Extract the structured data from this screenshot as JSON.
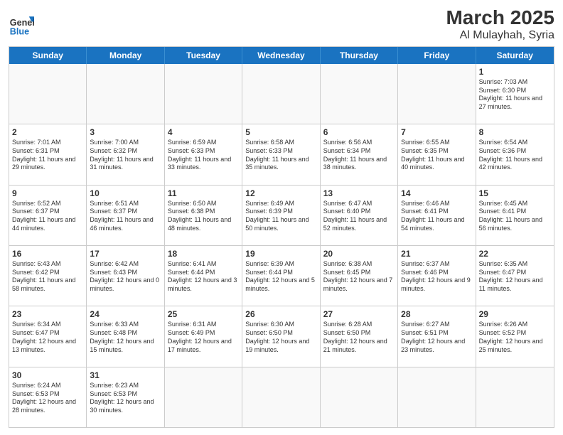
{
  "header": {
    "logo_general": "General",
    "logo_blue": "Blue",
    "title": "March 2025",
    "subtitle": "Al Mulayhah, Syria"
  },
  "days": [
    "Sunday",
    "Monday",
    "Tuesday",
    "Wednesday",
    "Thursday",
    "Friday",
    "Saturday"
  ],
  "weeks": [
    [
      {
        "day": "",
        "empty": true
      },
      {
        "day": "",
        "empty": true
      },
      {
        "day": "",
        "empty": true
      },
      {
        "day": "",
        "empty": true
      },
      {
        "day": "",
        "empty": true
      },
      {
        "day": "",
        "empty": true
      },
      {
        "day": "1",
        "sunrise": "7:03 AM",
        "sunset": "6:30 PM",
        "daylight": "11 hours and 27 minutes."
      }
    ],
    [
      {
        "day": "2",
        "sunrise": "7:01 AM",
        "sunset": "6:31 PM",
        "daylight": "11 hours and 29 minutes."
      },
      {
        "day": "3",
        "sunrise": "7:00 AM",
        "sunset": "6:32 PM",
        "daylight": "11 hours and 31 minutes."
      },
      {
        "day": "4",
        "sunrise": "6:59 AM",
        "sunset": "6:33 PM",
        "daylight": "11 hours and 33 minutes."
      },
      {
        "day": "5",
        "sunrise": "6:58 AM",
        "sunset": "6:33 PM",
        "daylight": "11 hours and 35 minutes."
      },
      {
        "day": "6",
        "sunrise": "6:56 AM",
        "sunset": "6:34 PM",
        "daylight": "11 hours and 38 minutes."
      },
      {
        "day": "7",
        "sunrise": "6:55 AM",
        "sunset": "6:35 PM",
        "daylight": "11 hours and 40 minutes."
      },
      {
        "day": "8",
        "sunrise": "6:54 AM",
        "sunset": "6:36 PM",
        "daylight": "11 hours and 42 minutes."
      }
    ],
    [
      {
        "day": "9",
        "sunrise": "6:52 AM",
        "sunset": "6:37 PM",
        "daylight": "11 hours and 44 minutes."
      },
      {
        "day": "10",
        "sunrise": "6:51 AM",
        "sunset": "6:37 PM",
        "daylight": "11 hours and 46 minutes."
      },
      {
        "day": "11",
        "sunrise": "6:50 AM",
        "sunset": "6:38 PM",
        "daylight": "11 hours and 48 minutes."
      },
      {
        "day": "12",
        "sunrise": "6:49 AM",
        "sunset": "6:39 PM",
        "daylight": "11 hours and 50 minutes."
      },
      {
        "day": "13",
        "sunrise": "6:47 AM",
        "sunset": "6:40 PM",
        "daylight": "11 hours and 52 minutes."
      },
      {
        "day": "14",
        "sunrise": "6:46 AM",
        "sunset": "6:41 PM",
        "daylight": "11 hours and 54 minutes."
      },
      {
        "day": "15",
        "sunrise": "6:45 AM",
        "sunset": "6:41 PM",
        "daylight": "11 hours and 56 minutes."
      }
    ],
    [
      {
        "day": "16",
        "sunrise": "6:43 AM",
        "sunset": "6:42 PM",
        "daylight": "11 hours and 58 minutes."
      },
      {
        "day": "17",
        "sunrise": "6:42 AM",
        "sunset": "6:43 PM",
        "daylight": "12 hours and 0 minutes."
      },
      {
        "day": "18",
        "sunrise": "6:41 AM",
        "sunset": "6:44 PM",
        "daylight": "12 hours and 3 minutes."
      },
      {
        "day": "19",
        "sunrise": "6:39 AM",
        "sunset": "6:44 PM",
        "daylight": "12 hours and 5 minutes."
      },
      {
        "day": "20",
        "sunrise": "6:38 AM",
        "sunset": "6:45 PM",
        "daylight": "12 hours and 7 minutes."
      },
      {
        "day": "21",
        "sunrise": "6:37 AM",
        "sunset": "6:46 PM",
        "daylight": "12 hours and 9 minutes."
      },
      {
        "day": "22",
        "sunrise": "6:35 AM",
        "sunset": "6:47 PM",
        "daylight": "12 hours and 11 minutes."
      }
    ],
    [
      {
        "day": "23",
        "sunrise": "6:34 AM",
        "sunset": "6:47 PM",
        "daylight": "12 hours and 13 minutes."
      },
      {
        "day": "24",
        "sunrise": "6:33 AM",
        "sunset": "6:48 PM",
        "daylight": "12 hours and 15 minutes."
      },
      {
        "day": "25",
        "sunrise": "6:31 AM",
        "sunset": "6:49 PM",
        "daylight": "12 hours and 17 minutes."
      },
      {
        "day": "26",
        "sunrise": "6:30 AM",
        "sunset": "6:50 PM",
        "daylight": "12 hours and 19 minutes."
      },
      {
        "day": "27",
        "sunrise": "6:28 AM",
        "sunset": "6:50 PM",
        "daylight": "12 hours and 21 minutes."
      },
      {
        "day": "28",
        "sunrise": "6:27 AM",
        "sunset": "6:51 PM",
        "daylight": "12 hours and 23 minutes."
      },
      {
        "day": "29",
        "sunrise": "6:26 AM",
        "sunset": "6:52 PM",
        "daylight": "12 hours and 25 minutes."
      }
    ],
    [
      {
        "day": "30",
        "sunrise": "6:24 AM",
        "sunset": "6:53 PM",
        "daylight": "12 hours and 28 minutes."
      },
      {
        "day": "31",
        "sunrise": "6:23 AM",
        "sunset": "6:53 PM",
        "daylight": "12 hours and 30 minutes."
      },
      {
        "day": "",
        "empty": true
      },
      {
        "day": "",
        "empty": true
      },
      {
        "day": "",
        "empty": true
      },
      {
        "day": "",
        "empty": true
      },
      {
        "day": "",
        "empty": true
      }
    ]
  ]
}
